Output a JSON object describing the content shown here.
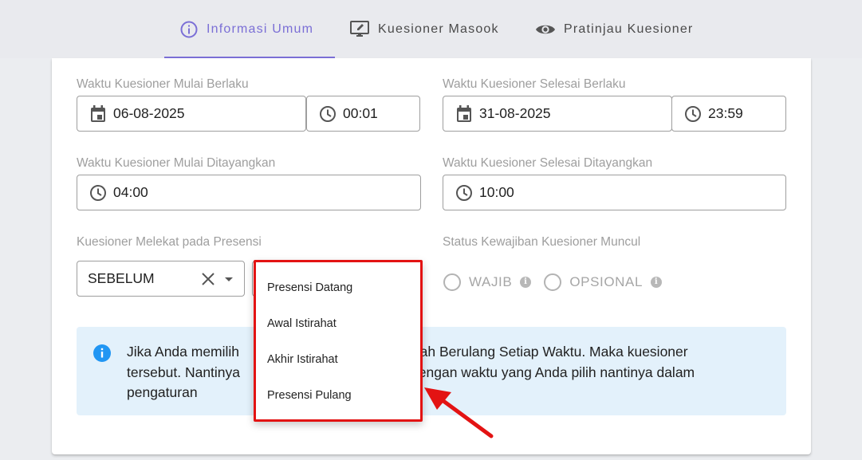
{
  "tabs": [
    {
      "label": "Informasi Umum",
      "icon": "info-circle-icon",
      "active": true
    },
    {
      "label": "Kuesioner Masook",
      "icon": "monitor-edit-icon",
      "active": false
    },
    {
      "label": "Pratinjau Kuesioner",
      "icon": "eye-icon",
      "active": false
    }
  ],
  "start_valid": {
    "label": "Waktu Kuesioner Mulai Berlaku",
    "date": "06-08-2025",
    "time": "00:01"
  },
  "end_valid": {
    "label": "Waktu Kuesioner Selesai Berlaku",
    "date": "31-08-2025",
    "time": "23:59"
  },
  "start_shown": {
    "label": "Waktu Kuesioner Mulai Ditayangkan",
    "time": "04:00"
  },
  "end_shown": {
    "label": "Waktu Kuesioner Selesai Ditayangkan",
    "time": "10:00"
  },
  "attach": {
    "label": "Kuesioner Melekat pada Presensi",
    "value": "SEBELUM"
  },
  "obligation": {
    "label": "Status Kewajiban Kuesioner Muncul",
    "options": [
      "WAJIB",
      "OPSIONAL"
    ]
  },
  "alert": {
    "line1_left": "Jika Anda memilih",
    "line1_right": "alah Berulang Setiap Waktu. Maka kuesioner",
    "line2_left": "tersebut. Nantinya",
    "line2_right": "dengan waktu yang Anda pilih nantinya dalam",
    "line3": "pengaturan"
  },
  "menu": {
    "items": [
      "Presensi Datang",
      "Awal Istirahat",
      "Akhir Istirahat",
      "Presensi Pulang"
    ]
  },
  "colors": {
    "accent": "#7b6fd6",
    "highlight": "#e31313",
    "info": "#2196f3",
    "alert_bg": "#e3f1fb"
  }
}
